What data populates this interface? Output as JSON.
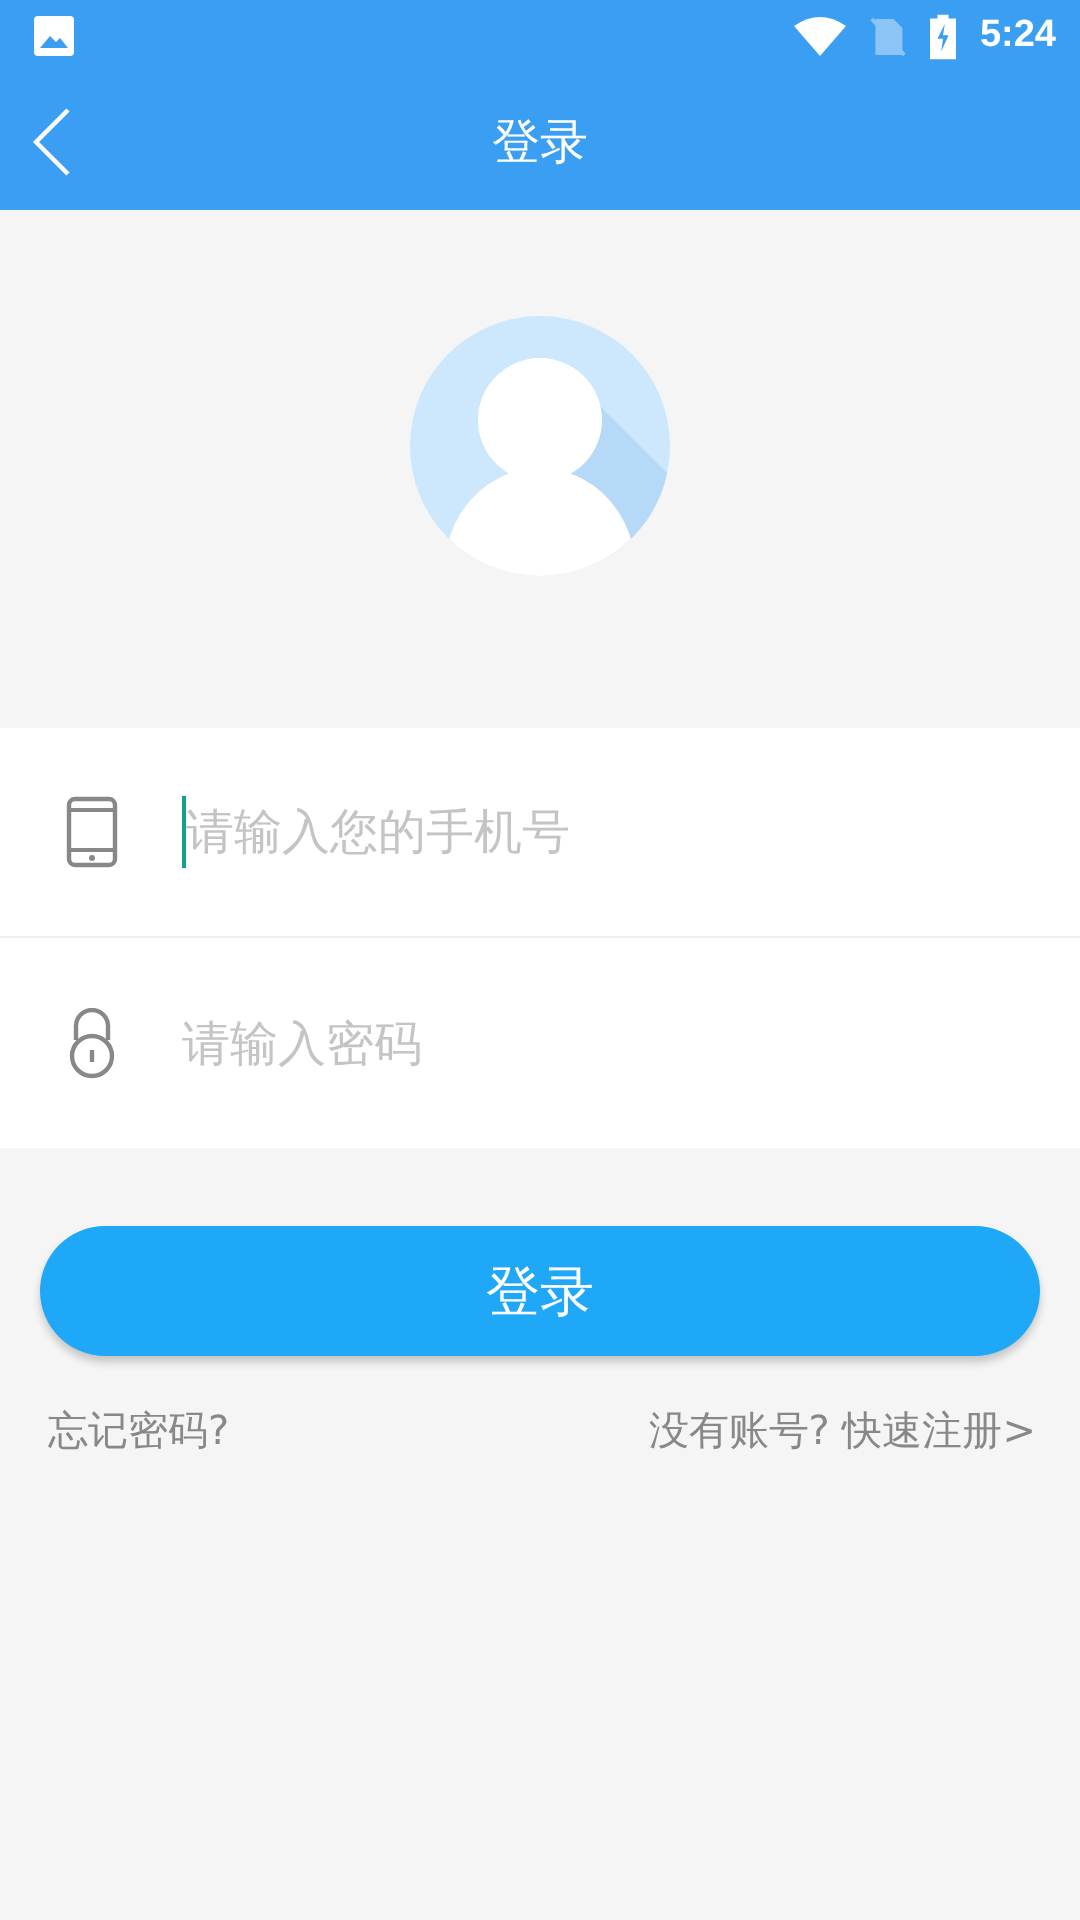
{
  "status_bar": {
    "time": "5:24"
  },
  "app_bar": {
    "title": "登录"
  },
  "form": {
    "fields": [
      {
        "kind": "phone",
        "placeholder": "请输入您的手机号",
        "focused": true
      },
      {
        "kind": "password",
        "placeholder": "请输入密码",
        "focused": false
      }
    ]
  },
  "login_button": "登录",
  "links": {
    "forgot": "忘记密码?",
    "register": "没有账号? 快速注册>"
  }
}
